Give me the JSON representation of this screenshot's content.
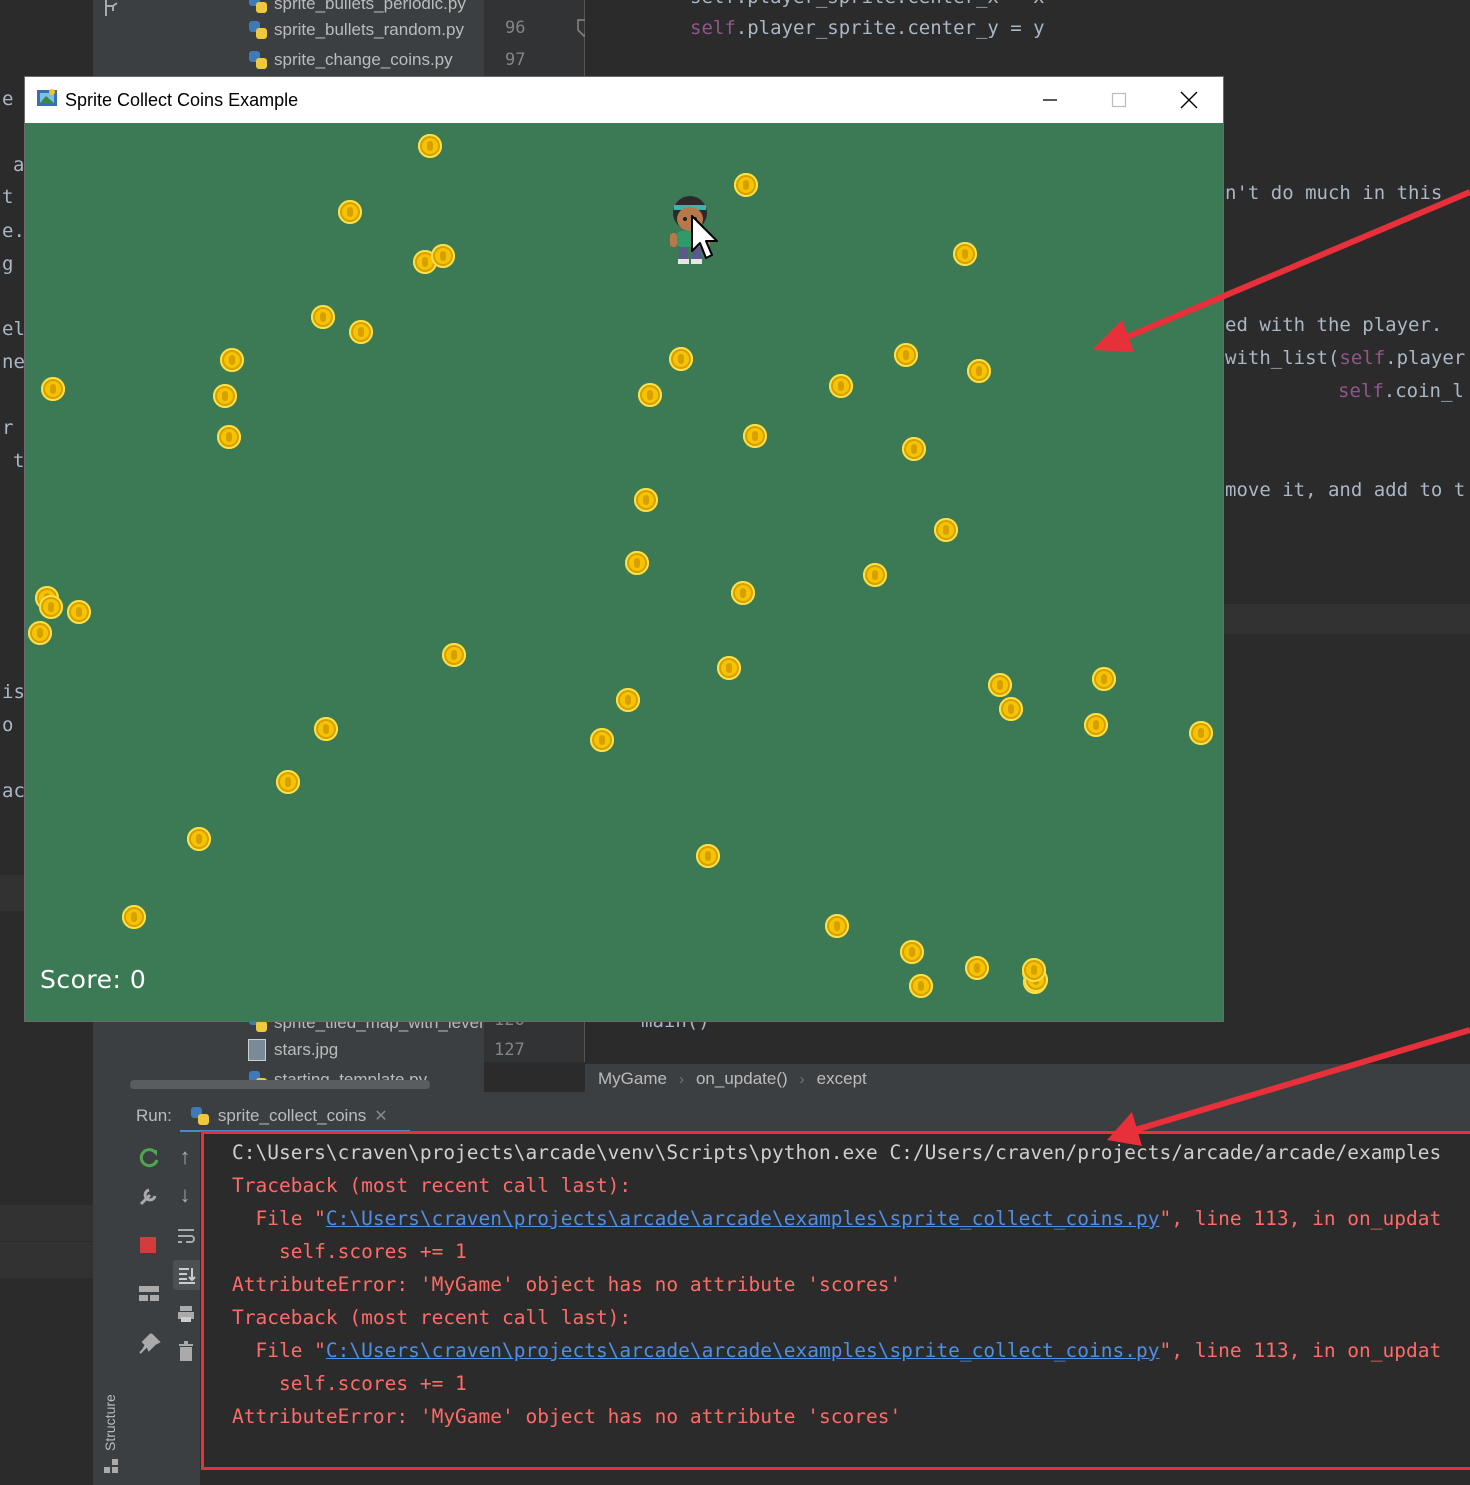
{
  "ide": {
    "left_fragments": [
      "e",
      "a",
      "t",
      "e.",
      "g",
      "el",
      "ne",
      "r",
      "t",
      "is",
      "o",
      "ac"
    ],
    "project_files": [
      {
        "name": "sprite_bullets_periodic.py",
        "type": "py"
      },
      {
        "name": "sprite_bullets_random.py",
        "type": "py"
      },
      {
        "name": "sprite_change_coins.py",
        "type": "py"
      },
      {
        "name": "sprite_tiled_map_with_level",
        "type": "py"
      },
      {
        "name": "stars.jpg",
        "type": "img"
      },
      {
        "name": "starting_template.py",
        "type": "py"
      }
    ],
    "line_numbers": {
      "top": [
        "96",
        "97"
      ],
      "bottom": [
        "126",
        "127"
      ]
    },
    "code_lines": [
      "self.player_sprite.center_x = x",
      "self.player_sprite.center_y = y",
      "n't do much in this",
      "ed with the player.",
      "with_list(self.player",
      "self.coin_l",
      "move it, and add to t",
      "main()"
    ],
    "breadcrumbs": [
      "MyGame",
      "on_update()",
      "except"
    ]
  },
  "run_panel": {
    "label": "Run:",
    "tab": "sprite_collect_coins",
    "tab_close": "✕",
    "structure_label": "Structure",
    "console_lines": [
      {
        "style": "white",
        "text": "C:\\Users\\craven\\projects\\arcade\\venv\\Scripts\\python.exe C:/Users/craven/projects/arcade/arcade/examples"
      },
      {
        "style": "red",
        "text": "Traceback (most recent call last):"
      },
      {
        "style": "file",
        "prefix": "  File \"",
        "link": "C:\\Users\\craven\\projects\\arcade\\arcade\\examples\\sprite_collect_coins.py",
        "suffix": "\", line 113, in on_updat"
      },
      {
        "style": "red",
        "text": "    self.scores += 1"
      },
      {
        "style": "red",
        "text": "AttributeError: 'MyGame' object has no attribute 'scores'"
      },
      {
        "style": "red",
        "text": "Traceback (most recent call last):"
      },
      {
        "style": "file",
        "prefix": "  File \"",
        "link": "C:\\Users\\craven\\projects\\arcade\\arcade\\examples\\sprite_collect_coins.py",
        "suffix": "\", line 113, in on_updat"
      },
      {
        "style": "red",
        "text": "    self.scores += 1"
      },
      {
        "style": "red",
        "text": "AttributeError: 'MyGame' object has no attribute 'scores'"
      }
    ]
  },
  "game_window": {
    "title": "Sprite Collect Coins Example",
    "score_label": "Score: 0",
    "background_color": "#3b7a55",
    "coin_color": "#f5c400",
    "coin_count": 50
  },
  "annotation": {
    "arrow_color": "#e8303a"
  }
}
